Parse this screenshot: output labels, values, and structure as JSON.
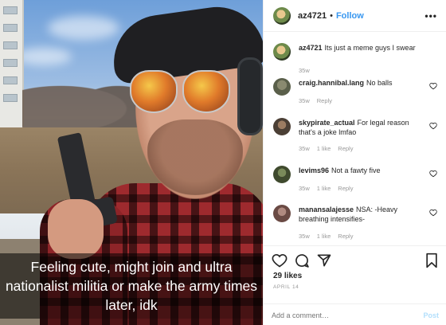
{
  "post": {
    "caption": "Feeling cute, might join and ultra nationalist militia or make the army times later, idk"
  },
  "header": {
    "username": "az4721",
    "separator": "•",
    "follow_label": "Follow",
    "more_label": "•••"
  },
  "comments": [
    {
      "username": "az4721",
      "text": "Its just a meme guys I swear",
      "age": "35w",
      "likes": "",
      "reply": "",
      "avatar_color": "#6d8a4a",
      "has_heart": false
    },
    {
      "username": "craig.hannibal.lang",
      "text": "No balls",
      "age": "35w",
      "likes": "",
      "reply": "Reply",
      "avatar_color": "#5a5f4a",
      "has_heart": true
    },
    {
      "username": "skypirate_actual",
      "text": "For legal reason that's a joke lmfao",
      "age": "35w",
      "likes": "1 like",
      "reply": "Reply",
      "avatar_color": "#4b3f35",
      "has_heart": true
    },
    {
      "username": "levims96",
      "text": "Not a fawty five",
      "age": "35w",
      "likes": "1 like",
      "reply": "Reply",
      "avatar_color": "#3f4a2e",
      "has_heart": true
    },
    {
      "username": "manansalajesse",
      "text": "NSA: -Heavy breathing intensifies-",
      "age": "35w",
      "likes": "1 like",
      "reply": "Reply",
      "avatar_color": "#6a4a44",
      "has_heart": true
    }
  ],
  "footer": {
    "likes_text": "29 likes",
    "date_text": "APRIL 14",
    "add_comment_placeholder": "Add a comment…",
    "post_label": "Post"
  },
  "icons": {
    "like": "heart-icon",
    "comment": "comment-icon",
    "share": "share-icon",
    "save": "bookmark-icon",
    "more": "more-icon"
  },
  "colors": {
    "link_blue": "#3897f0",
    "post_disabled": "#b2dffc",
    "meta_gray": "#999999",
    "caption_bg": "rgba(0,0,0,0.55)"
  }
}
